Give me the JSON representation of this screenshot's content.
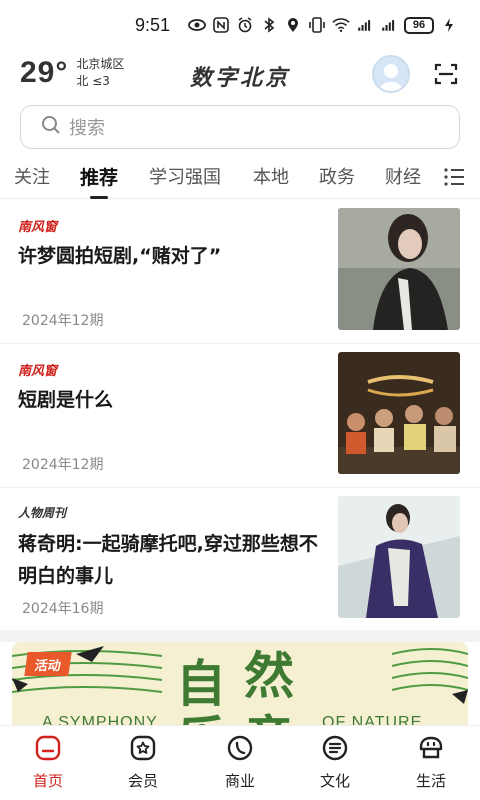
{
  "status_bar": {
    "time": "9:51",
    "battery": "96"
  },
  "header": {
    "temperature": "29°",
    "location": "北京城区",
    "wind": "北 ≤3",
    "logo_text": "数字北京"
  },
  "search": {
    "placeholder": "搜索"
  },
  "tabs": [
    {
      "label": "关注"
    },
    {
      "label": "推荐"
    },
    {
      "label": "学习强国"
    },
    {
      "label": "本地"
    },
    {
      "label": "政务"
    },
    {
      "label": "财经"
    }
  ],
  "articles": [
    {
      "source": "南风窗",
      "title": "许梦圆拍短剧,“赌对了”",
      "date": "2024年12期"
    },
    {
      "source": "南风窗",
      "title": "短剧是什么",
      "date": "2024年12期"
    },
    {
      "source": "人物周刊",
      "title": "蒋奇明:一起骑摩托吧,穿过那些想不明白的事儿",
      "date": "2024年16期"
    }
  ],
  "banner": {
    "badge": "活动",
    "char_1": "自",
    "char_2": "然",
    "char_3": "乐",
    "char_4": "章",
    "text_left": "A SYMPHONY",
    "text_right": "OF NATURE"
  },
  "bottom_nav": [
    {
      "label": "首页"
    },
    {
      "label": "会员"
    },
    {
      "label": "商业"
    },
    {
      "label": "文化"
    },
    {
      "label": "生活"
    }
  ],
  "colors": {
    "accent": "#d0211c",
    "banner_green": "#3f7a33",
    "banner_bg": "#f5f0d2"
  }
}
